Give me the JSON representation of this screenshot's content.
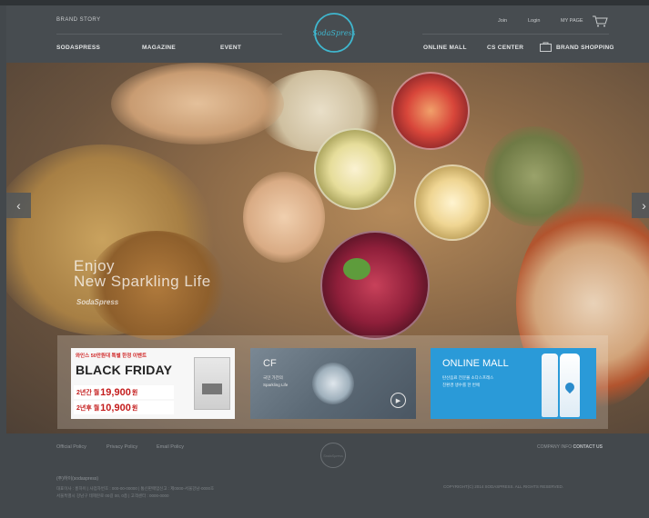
{
  "header": {
    "brand_story": "BRAND STORY",
    "nav_left": [
      "SODASPRESS",
      "MAGAZINE",
      "EVENT"
    ],
    "logo_text": "SodaSpress",
    "utility": [
      "Join",
      "Login",
      "MY PAGE"
    ],
    "nav_right": [
      "ONLINE MALL",
      "CS CENTER",
      "BRAND SHOPPING"
    ]
  },
  "hero": {
    "line1": "Enjoy",
    "line2": "New Sparkling Life",
    "brand": "SodaSpress",
    "prev_label": "‹",
    "next_label": "›"
  },
  "banners": {
    "black_friday": {
      "top_text": "와인스 50만원대 특별 한정 이벤트",
      "title": "BLACK FRIDAY",
      "row1_pre": "2년간 월",
      "row1_price": "19,900",
      "row1_post": "원",
      "row2_pre": "2년후 월",
      "row2_price": "10,900",
      "row2_post": "원"
    },
    "cf": {
      "title": "CF",
      "line1": "국민 가전의",
      "line2": "Sparkling Life",
      "play": "▶"
    },
    "online_mall": {
      "title": "ONLINE MALL",
      "line1": "탄산음료 전문몰 소다스프레스",
      "line2": "친환경 생수를 한 번에"
    }
  },
  "footer": {
    "links": [
      "Official Policy",
      "Privacy Policy",
      "Email Policy"
    ],
    "logo_text": "SodaSpress",
    "right_label": "COMPANY INFO",
    "right_value": "CONTACT US",
    "company": "(주)하이(sodaspress)",
    "address_line1": "대표이사 : 홍하이 | 사업자번호 : 000-00-00000 | 통신판매업신고 : 제0000-서울강남-0000호",
    "address_line2": "서울특별시 강남구 테헤란로 00길 00, 0층 | 고객센터 : 0000-0000",
    "copyright": "COPYRIGHT(C) 2014 SODASPRESS. ALL RIGHTS RESERVED."
  },
  "colors": {
    "header_bg": "#474c50",
    "logo_accent": "#3fb7cf",
    "bf_price": "#c41c1c",
    "online_mall_blue": "#2a9ad8"
  }
}
